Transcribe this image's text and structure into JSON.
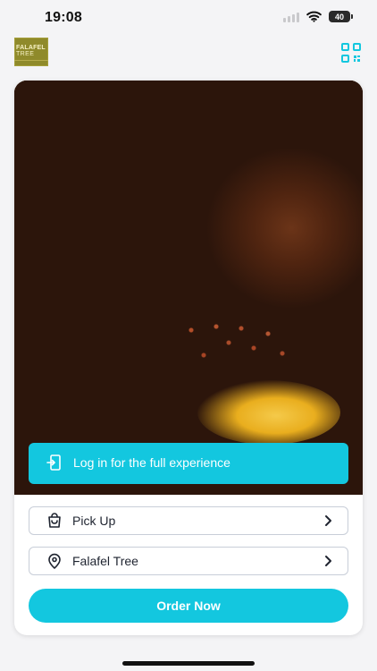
{
  "status_bar": {
    "time": "19:08",
    "battery_level": "40"
  },
  "header": {
    "logo_text_line1": "FALAFEL",
    "logo_text_line2": "TREE",
    "qr_icon": "qr-code-icon"
  },
  "hero": {
    "login_banner": "Log in for the full experience",
    "login_icon": "login-door-icon"
  },
  "options": [
    {
      "label": "Pick Up",
      "icon": "shopping-bag-icon"
    },
    {
      "label": "Falafel Tree",
      "icon": "location-pin-icon"
    }
  ],
  "cta": {
    "label": "Order Now"
  },
  "colors": {
    "accent": "#13c7df",
    "border": "#c8ced8",
    "text": "#1f2430"
  }
}
